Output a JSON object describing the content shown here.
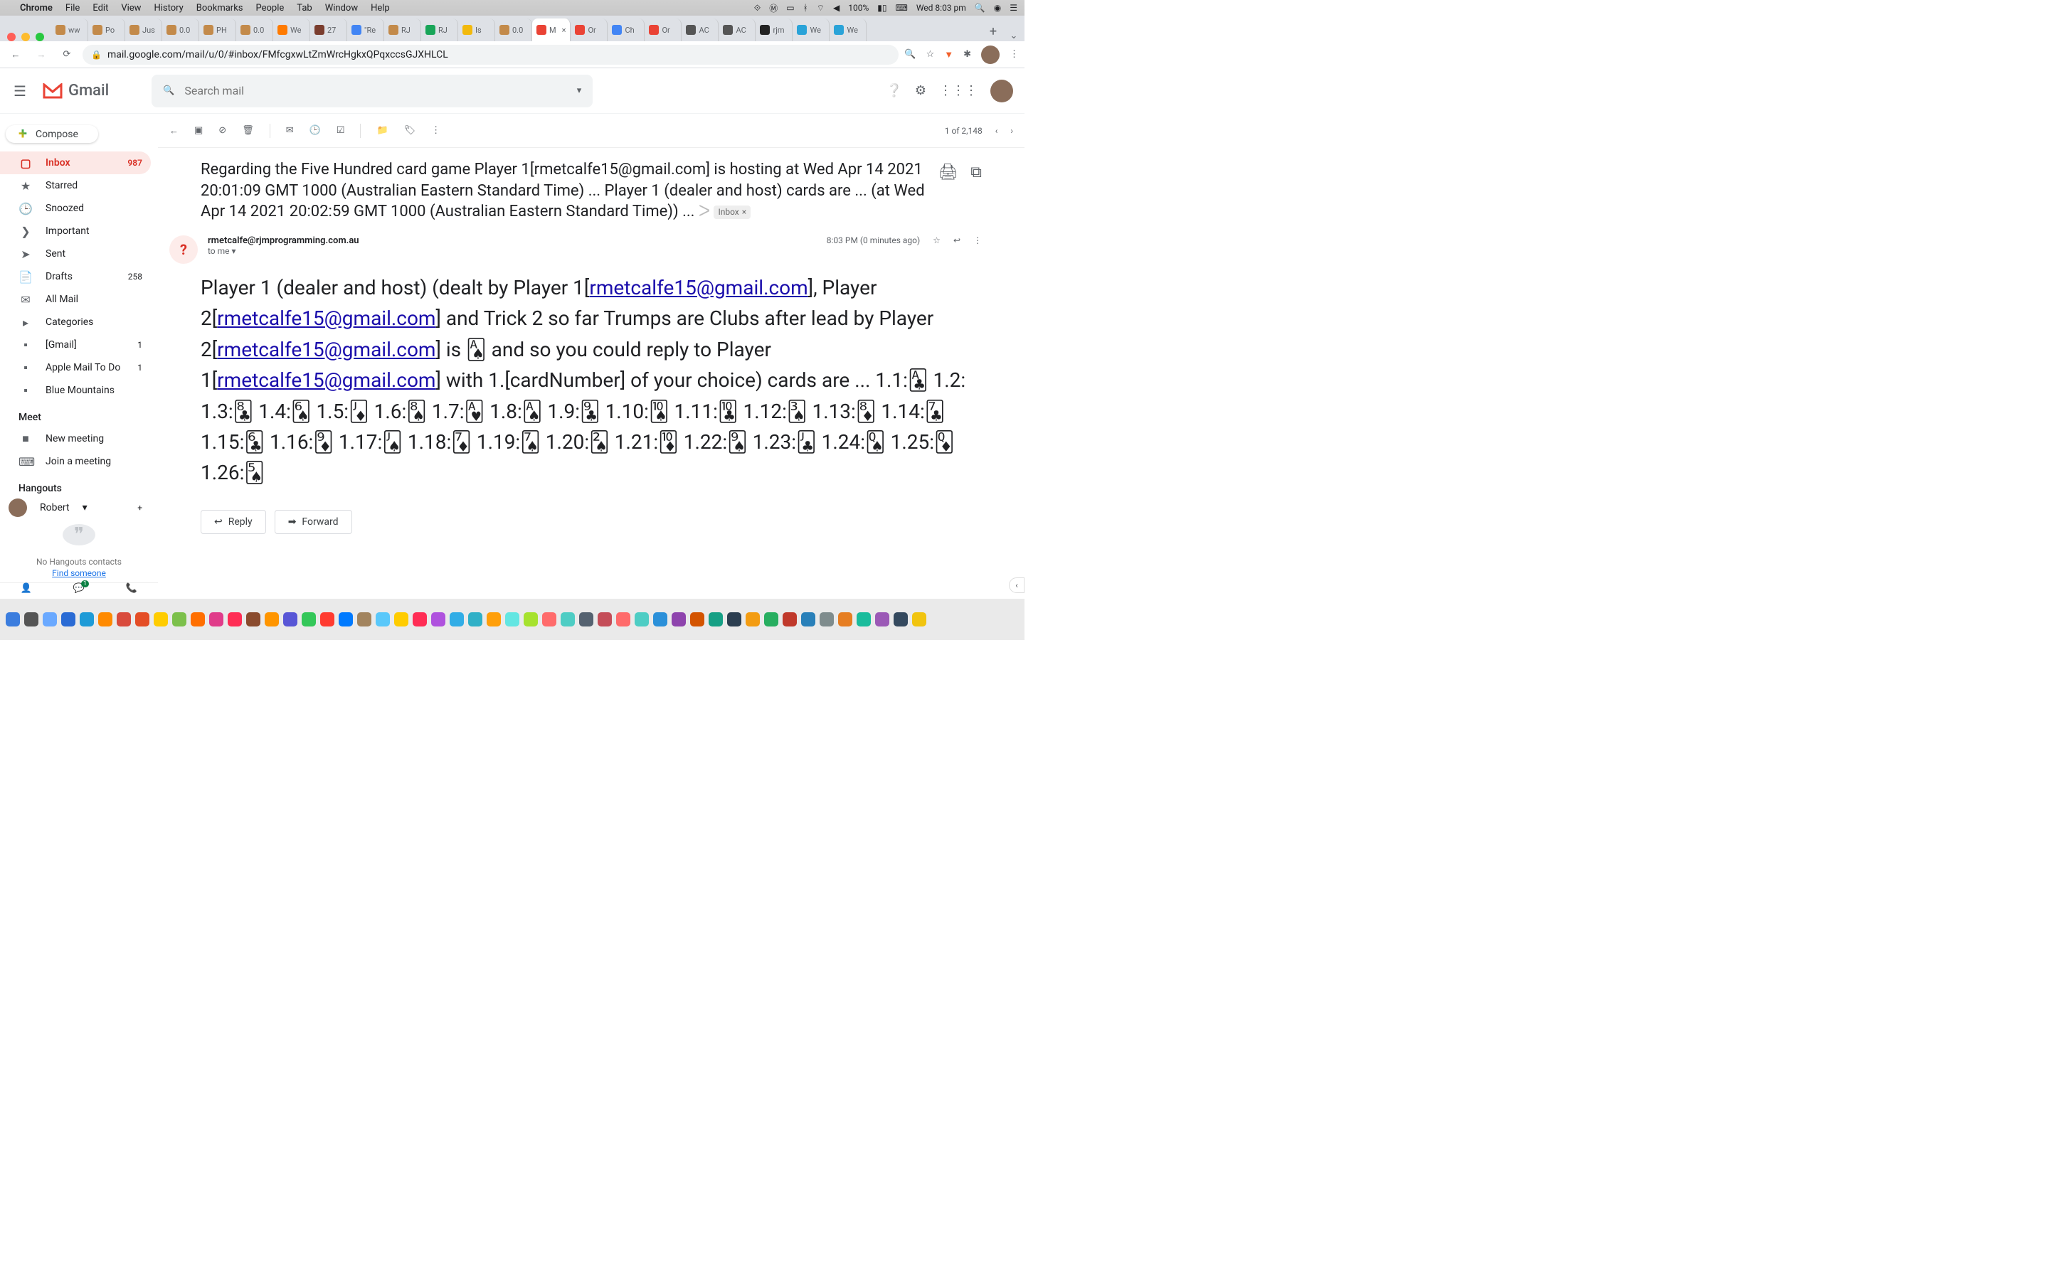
{
  "menubar": {
    "app": "Chrome",
    "items": [
      "File",
      "Edit",
      "View",
      "History",
      "Bookmarks",
      "People",
      "Tab",
      "Window",
      "Help"
    ],
    "battery": "100%",
    "clock": "Wed 8:03 pm"
  },
  "tabs": [
    {
      "label": "ww",
      "fav": "#c38a4a"
    },
    {
      "label": "Po",
      "fav": "#c38a4a"
    },
    {
      "label": "Jus",
      "fav": "#c38a4a"
    },
    {
      "label": "0.0",
      "fav": "#c38a4a"
    },
    {
      "label": "PH",
      "fav": "#c38a4a"
    },
    {
      "label": "0.0",
      "fav": "#c38a4a"
    },
    {
      "label": "We",
      "fav": "#ff7a00"
    },
    {
      "label": "27",
      "fav": "#7a3d2e"
    },
    {
      "label": "\"Re",
      "fav": "#4285f4"
    },
    {
      "label": "RJ",
      "fav": "#c38a4a"
    },
    {
      "label": "RJ",
      "fav": "#18a558"
    },
    {
      "label": "Is",
      "fav": "#f2b90c"
    },
    {
      "label": "0.0",
      "fav": "#c38a4a"
    },
    {
      "label": "M",
      "fav": "#ea4335",
      "active": true,
      "close": true
    },
    {
      "label": "Or",
      "fav": "#ea4335"
    },
    {
      "label": "Ch",
      "fav": "#4285f4"
    },
    {
      "label": "Or",
      "fav": "#ea4335"
    },
    {
      "label": "AC",
      "fav": "#555"
    },
    {
      "label": "AC",
      "fav": "#555"
    },
    {
      "label": "rjm",
      "fav": "#222"
    },
    {
      "label": "We",
      "fav": "#2aa3d8"
    },
    {
      "label": "We",
      "fav": "#2aa3d8"
    }
  ],
  "url": "mail.google.com/mail/u/0/#inbox/FMfcgxwLtZmWrcHgkxQPqxccsGJXHLCL",
  "gmail": {
    "brand": "Gmail",
    "searchPlaceholder": "Search mail",
    "compose": "Compose",
    "nav": [
      {
        "icon": "▢",
        "label": "Inbox",
        "count": "987",
        "active": true
      },
      {
        "icon": "★",
        "label": "Starred"
      },
      {
        "icon": "🕒",
        "label": "Snoozed"
      },
      {
        "icon": "❯",
        "label": "Important"
      },
      {
        "icon": "➤",
        "label": "Sent"
      },
      {
        "icon": "📄",
        "label": "Drafts",
        "count": "258"
      },
      {
        "icon": "✉",
        "label": "All Mail"
      },
      {
        "icon": "▸",
        "label": "Categories"
      },
      {
        "icon": "▪",
        "label": "[Gmail]",
        "count": "1"
      },
      {
        "icon": "▪",
        "label": "Apple Mail To Do",
        "count": "1"
      },
      {
        "icon": "▪",
        "label": "Blue Mountains"
      }
    ],
    "meetHead": "Meet",
    "meet": [
      {
        "icon": "■",
        "label": "New meeting"
      },
      {
        "icon": "⌨",
        "label": "Join a meeting"
      }
    ],
    "hangoutsHead": "Hangouts",
    "hangoutsUser": "Robert",
    "noHang": "No Hangouts contacts",
    "findSomeone": "Find someone",
    "counter": "1 of 2,148"
  },
  "email": {
    "subject_a": "Regarding the Five Hundred card game Player 1[rmetcalfe15@gmail.com] is hosting at Wed Apr 14 2021 20:01:09 GMT 1000 (Australian Eastern Standard Time) ... Player 1 (dealer and host) cards are ... (at Wed Apr 14 2021 20:02:59 GMT 1000 (Australian Eastern Standard Time)) ... ",
    "labelChip": "Inbox",
    "from": "rmetcalfe@rjmprogramming.com.au",
    "to": "to me",
    "time": "8:03 PM (0 minutes ago)",
    "body_p1_a": "Player 1 (dealer and host) (dealt by Player 1[",
    "link1": "rmetcalfe15@gmail.com",
    "body_p1_b": "], Player 2[",
    "link2": "rmetcalfe15@gmail.com",
    "body_p1_c": "] and Trick 2 so far Trumps are Clubs after lead by Player 2[",
    "link3": "rmetcalfe15@gmail.com",
    "body_p1_d": "] is 🂡 and so you could reply to Player 1[",
    "link4": "rmetcalfe15@gmail.com",
    "body_p1_e": "] with 1.[cardNumber] of your choice) cards are ... 1.1:🃑 1.2: 1.3:🃘 1.4:🂦 1.5:🃋 1.6:🂨 1.7:🂱 1.8:🂡 1.9:🃙 1.10:🂪 1.11:🃚 1.12:🂣 1.13:🃈 1.14:🃗 1.15:🃖 1.16:🃉 1.17:🂫 1.18:🃇 1.19:🂧 1.20:🂢 1.21:🃊 1.22:🂩 1.23:🃛 1.24:🂭 1.25:🃍 1.26:🂥",
    "reply": "Reply",
    "forward": "Forward"
  },
  "dockColors": [
    "#3b7dde",
    "#555",
    "#6aa9ff",
    "#2a6bd4",
    "#1e9bd7",
    "#ff8a00",
    "#d94b3d",
    "#e44d26",
    "#ffcc00",
    "#7cc04b",
    "#ff6f00",
    "#e03c8a",
    "#ff2d55",
    "#8a4b2e",
    "#ff9500",
    "#5856d6",
    "#34c759",
    "#ff3b30",
    "#007aff",
    "#a2845e",
    "#5ac8fa",
    "#ffcc00",
    "#ff2d55",
    "#af52de",
    "#32ade6",
    "#30b0c7",
    "#ff9f0a",
    "#63e6e2",
    "#a6e22e",
    "#ff6b6b",
    "#4ecdc4",
    "#556270",
    "#c44d58",
    "#ff6b6b",
    "#4ecdc4",
    "#2b90d9",
    "#8e44ad",
    "#d35400",
    "#16a085",
    "#2c3e50",
    "#f39c12",
    "#27ae60",
    "#c0392b",
    "#2980b9",
    "#7f8c8d",
    "#e67e22",
    "#1abc9c",
    "#9b59b6",
    "#34495e",
    "#f1c40f"
  ]
}
